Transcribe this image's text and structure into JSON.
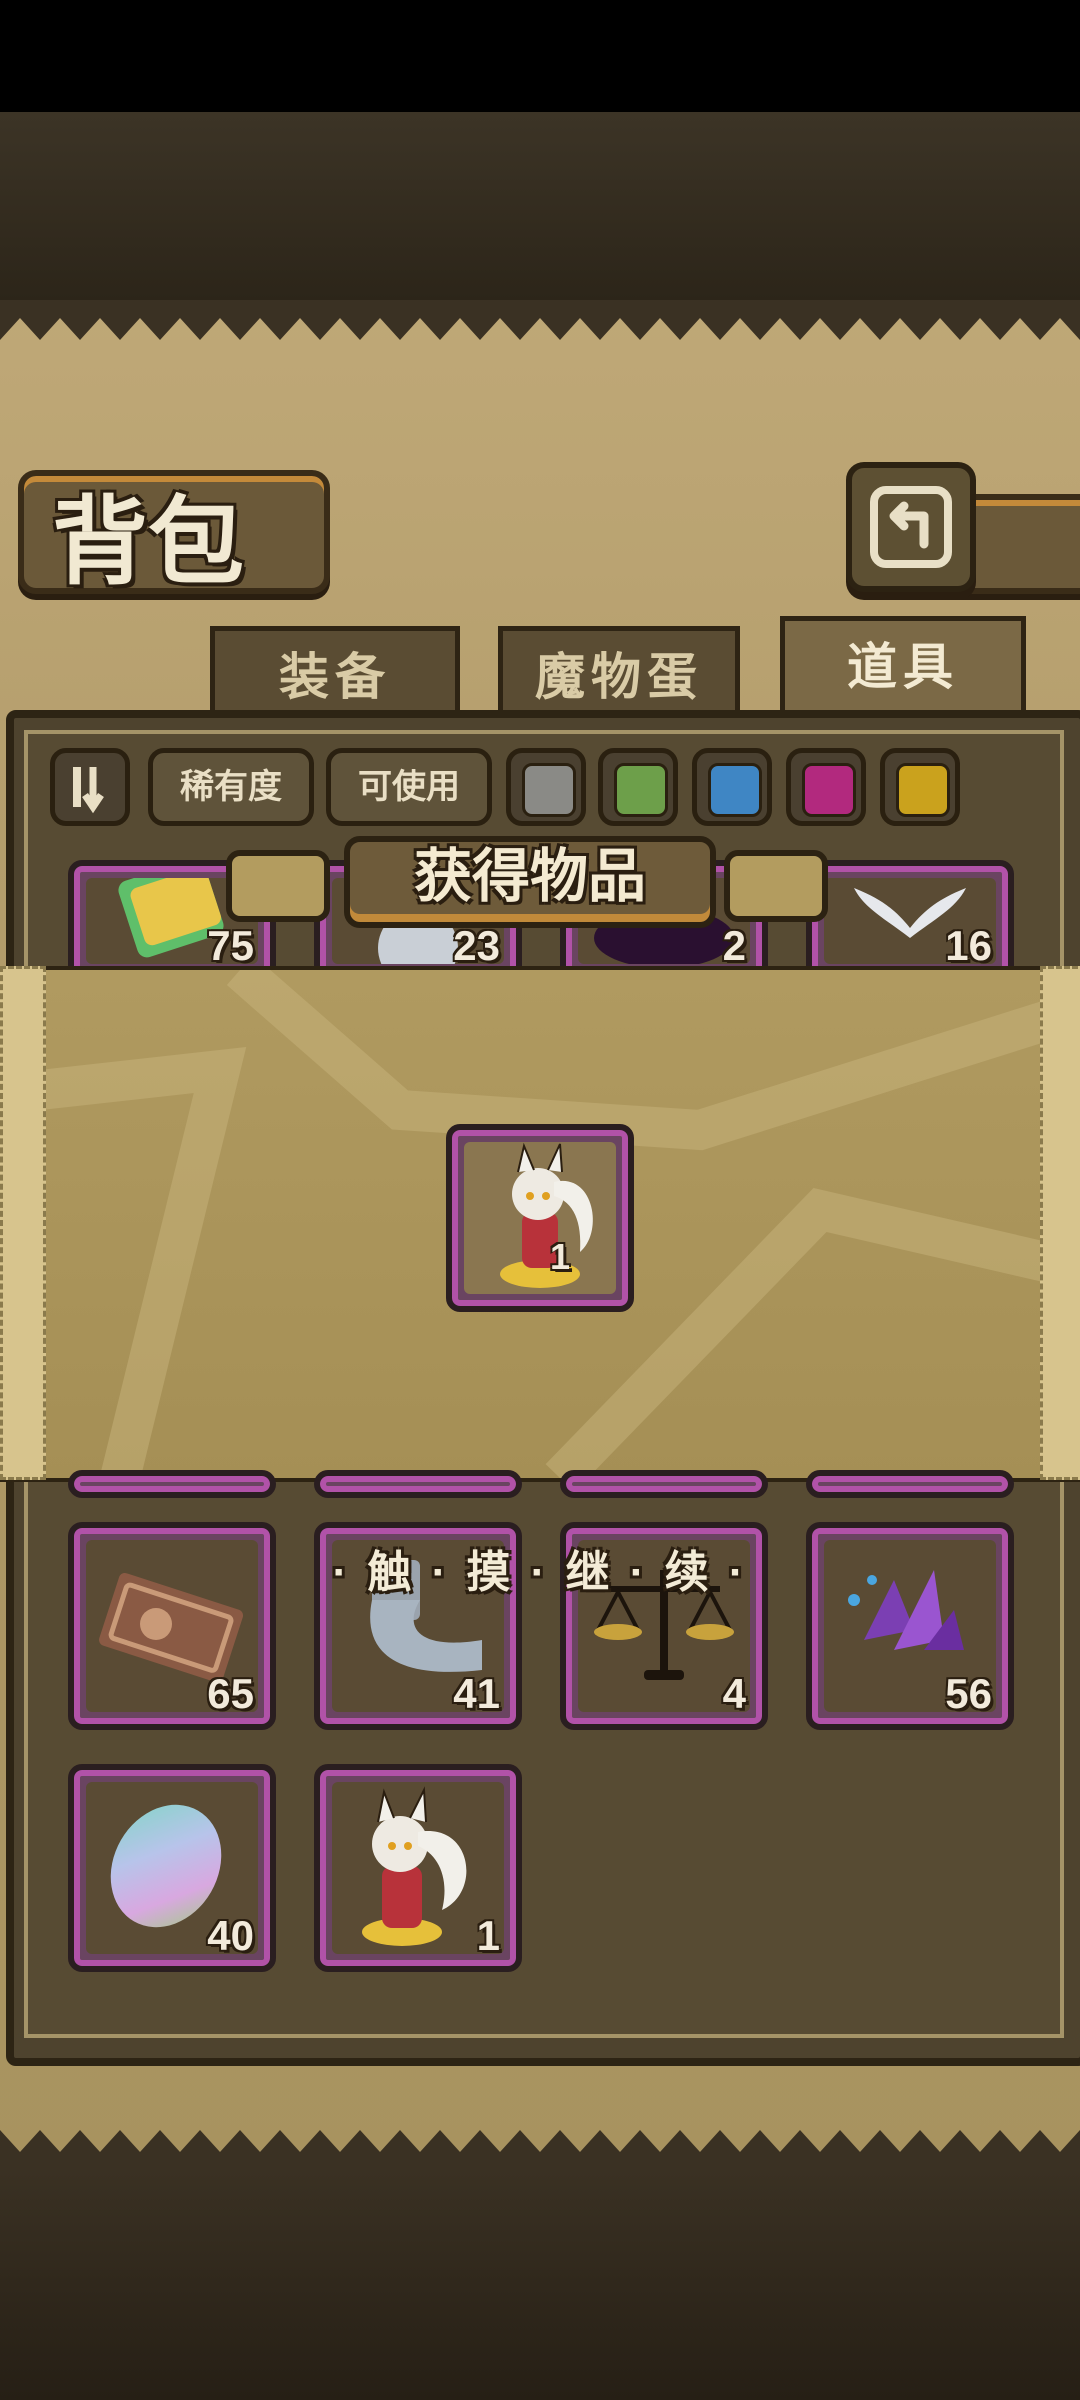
{
  "header": {
    "title": "背包",
    "back_icon": "back-arrow-icon"
  },
  "tabs": [
    {
      "label": "装备",
      "active": false
    },
    {
      "label": "魔物蛋",
      "active": false
    },
    {
      "label": "道具",
      "active": true
    }
  ],
  "filters": {
    "sort_icon": "sort-icon",
    "rarity_label": "稀有度",
    "usable_label": "可使用",
    "colors": [
      "#8a8a86",
      "#6d9f4a",
      "#3f86c4",
      "#b2297e",
      "#caa21d"
    ]
  },
  "partial_row_counts": [
    "75",
    "23",
    "2",
    "16"
  ],
  "items": [
    {
      "icon": "ticket-icon",
      "count": "65"
    },
    {
      "icon": "bandage-roll-icon",
      "count": "41"
    },
    {
      "icon": "balance-scale-icon",
      "count": "4"
    },
    {
      "icon": "purple-crystal-icon",
      "count": "56"
    },
    {
      "icon": "rainbow-egg-icon",
      "count": "40"
    },
    {
      "icon": "character-figure-icon",
      "count": "1"
    }
  ],
  "obtained": {
    "title": "获得物品",
    "item_icon": "character-figure-icon",
    "count": "1",
    "hint": "· 触 · 摸 · 继 · 续 ·"
  }
}
